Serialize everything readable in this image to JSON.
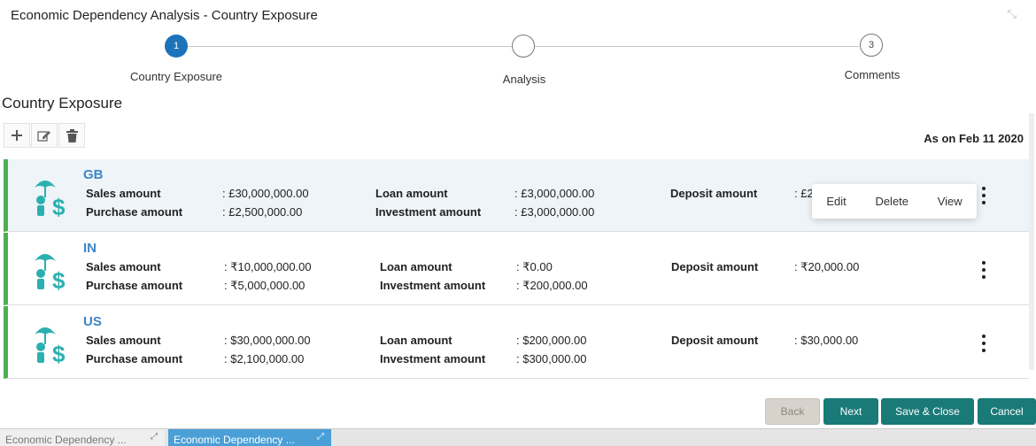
{
  "window": {
    "title": "Economic Dependency Analysis - Country Exposure"
  },
  "stepper": {
    "steps": [
      {
        "number": "1",
        "label": "Country Exposure",
        "state": "active"
      },
      {
        "number": "",
        "label": "Analysis",
        "state": "idle"
      },
      {
        "number": "3",
        "label": "Comments",
        "state": "idle"
      }
    ]
  },
  "section": {
    "title": "Country Exposure",
    "as_of": "As on Feb 11 2020"
  },
  "toolbar": {
    "add_icon": "plus-icon",
    "edit_icon": "edit-icon",
    "delete_icon": "trash-icon"
  },
  "cards": [
    {
      "country": "GB",
      "sales_label": "Sales amount",
      "sales_value": ": £30,000,000.00",
      "purchase_label": "Purchase amount",
      "purchase_value": ": £2,500,000.00",
      "loan_label": "Loan amount",
      "loan_value": ": £3,000,000.00",
      "investment_label": "Investment amount",
      "investment_value": ": £3,000,000.00",
      "deposit_label": "Deposit amount",
      "deposit_value": ": £2"
    },
    {
      "country": "IN",
      "sales_label": "Sales amount",
      "sales_value": ": ₹10,000,000.00",
      "purchase_label": "Purchase amount",
      "purchase_value": ": ₹5,000,000.00",
      "loan_label": "Loan amount",
      "loan_value": ": ₹0.00",
      "investment_label": "Investment amount",
      "investment_value": ": ₹200,000.00",
      "deposit_label": "Deposit amount",
      "deposit_value": ": ₹20,000.00"
    },
    {
      "country": "US",
      "sales_label": "Sales amount",
      "sales_value": ": $30,000,000.00",
      "purchase_label": "Purchase amount",
      "purchase_value": ": $2,100,000.00",
      "loan_label": "Loan amount",
      "loan_value": ": $200,000.00",
      "investment_label": "Investment amount",
      "investment_value": ": $300,000.00",
      "deposit_label": "Deposit amount",
      "deposit_value": ": $30,000.00"
    }
  ],
  "context_menu": {
    "edit": "Edit",
    "delete": "Delete",
    "view": "View"
  },
  "footer": {
    "back": "Back",
    "next": "Next",
    "save_close": "Save & Close",
    "cancel": "Cancel"
  },
  "taskbar": [
    {
      "label": "Economic Dependency ...",
      "active": false
    },
    {
      "label": "Economic Dependency ...",
      "active": true
    }
  ],
  "colors": {
    "accent": "#1d73ba",
    "primary_button": "#1a7a78",
    "card_border": "#4caf50",
    "country_text": "#3d86c6",
    "active_tab": "#4a9fd6"
  }
}
